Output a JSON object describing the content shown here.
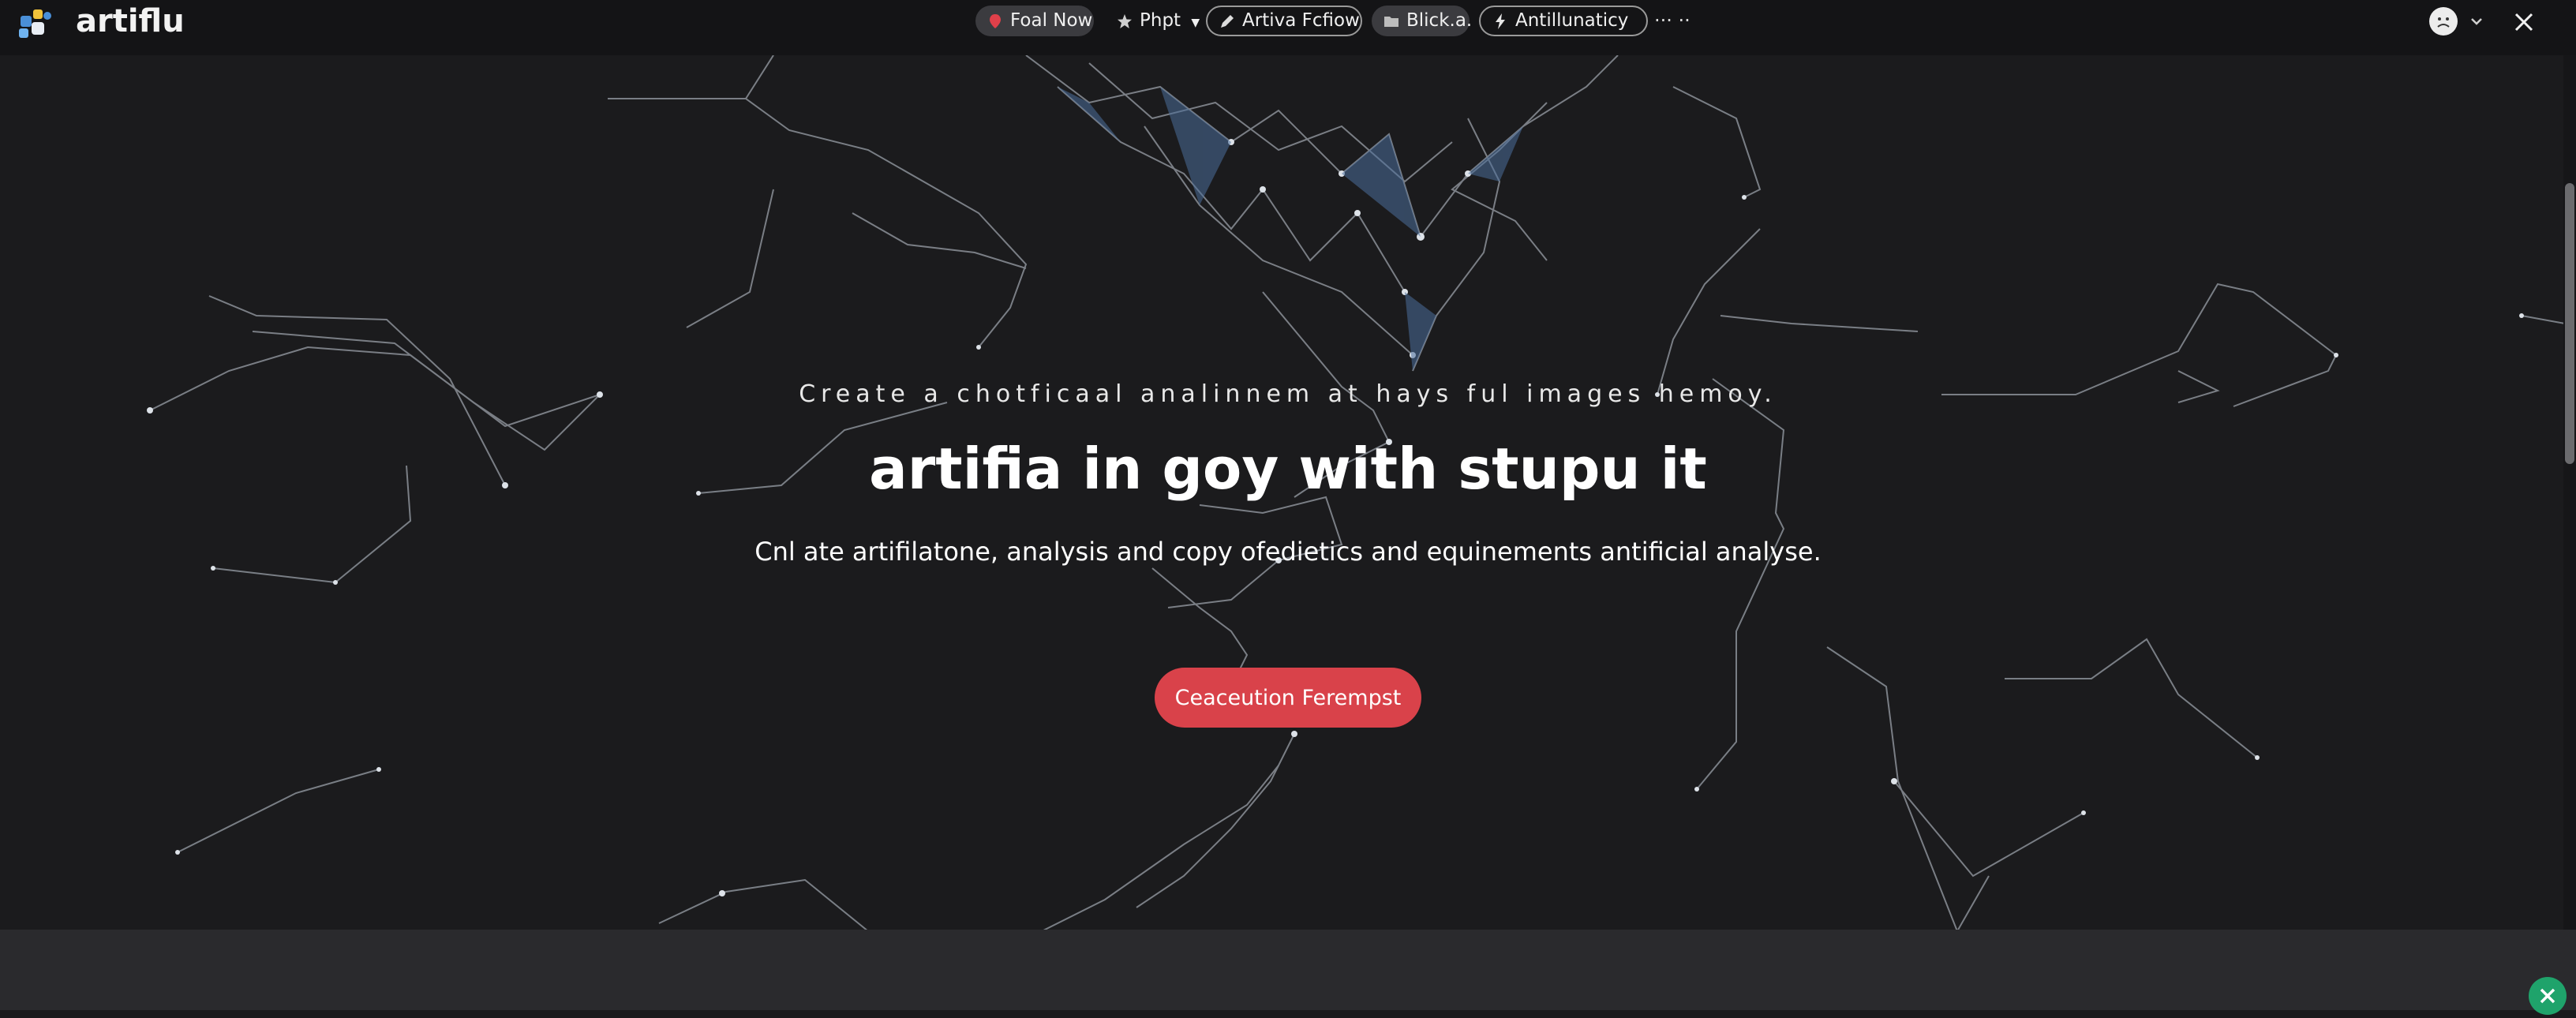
{
  "app": {
    "name": "artiflu"
  },
  "tabs": [
    {
      "label": "Foal Now",
      "icon": "pin-icon"
    },
    {
      "label": "Phpt",
      "icon": "star-icon",
      "has_dropdown": true
    },
    {
      "label": "Artiva Fcfiow",
      "icon": "pencil-icon"
    },
    {
      "label": "Blick.a.",
      "icon": "folder-icon"
    },
    {
      "label": "Antillunaticy",
      "icon": "lightning-icon"
    }
  ],
  "toolbar": {
    "more_label": "··· ··"
  },
  "hero": {
    "tagline": "Create a chotficaal analinnem at hays ful images hemoy.",
    "headline": "artifia in goy with stupu it",
    "subline": "Cnl ate artifilatone, analysis and copy ofedietics and equinements antificial analyse.",
    "cta_label": "Ceaceution Ferempst"
  },
  "colors": {
    "accent": "#d9424a",
    "background": "#1b1b1d",
    "topbar": "#141416",
    "close_badge": "#1fa36b"
  }
}
